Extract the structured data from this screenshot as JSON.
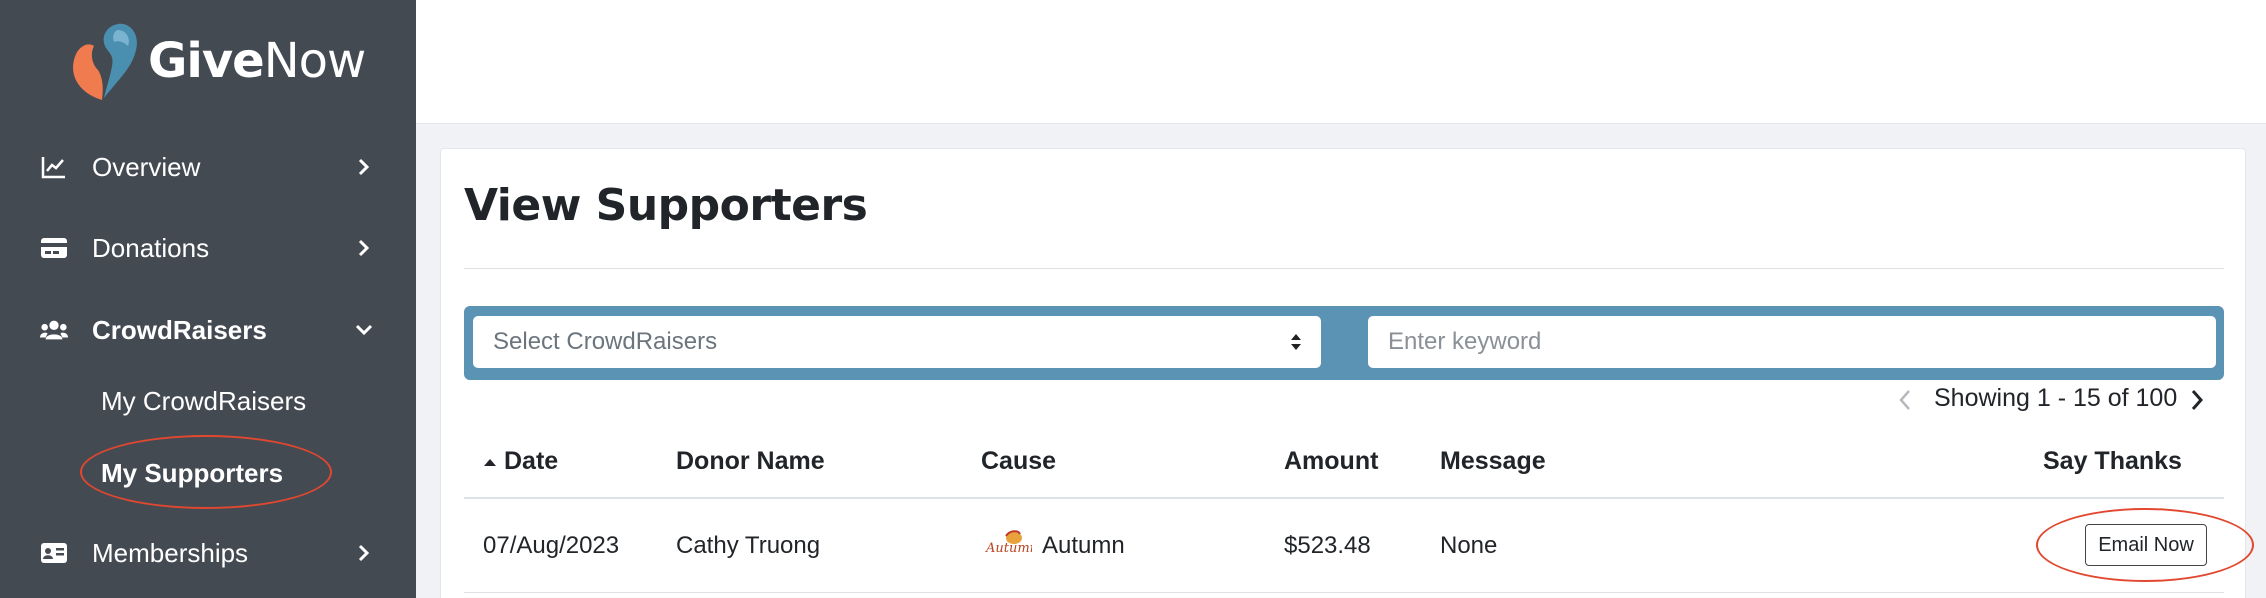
{
  "brand": {
    "logo_give": "Give",
    "logo_now": "Now",
    "accent": "#e2472f",
    "filter_bar_color": "#5b93b4",
    "sidebar_color": "#444a52"
  },
  "sidebar": {
    "items": [
      {
        "label": "Overview",
        "icon": "chart-line-icon"
      },
      {
        "label": "Donations",
        "icon": "credit-card-icon"
      },
      {
        "label": "CrowdRaisers",
        "icon": "users-icon"
      },
      {
        "label": "Memberships",
        "icon": "id-card-icon"
      }
    ],
    "sub_items": [
      {
        "label": "My CrowdRaisers"
      },
      {
        "label": "My Supporters"
      }
    ]
  },
  "main": {
    "title": "View Supporters",
    "filters": {
      "select_placeholder": "Select CrowdRaisers",
      "keyword_placeholder": "Enter keyword"
    },
    "pagination": {
      "text": "Showing 1 - 15 of 100"
    },
    "table": {
      "columns": [
        "Date",
        "Donor Name",
        "Cause",
        "Amount",
        "Message",
        "Say Thanks"
      ],
      "rows": [
        {
          "date": "07/Aug/2023",
          "donor": "Cathy Truong",
          "cause": "Autumn",
          "cause_logo_text": "Autumn",
          "amount": "$523.48",
          "message": "None",
          "action": "Email Now"
        }
      ]
    }
  }
}
